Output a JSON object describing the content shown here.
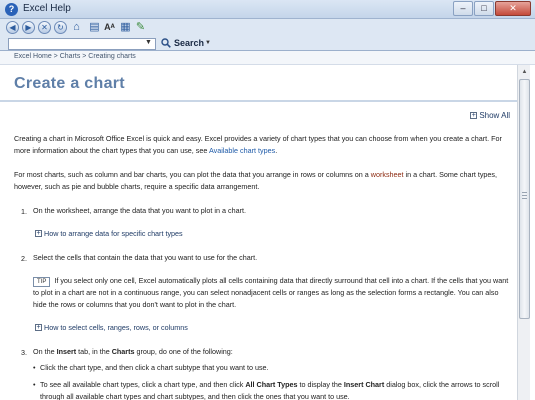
{
  "window": {
    "title": "Excel Help"
  },
  "window_buttons": {
    "minimize": "–",
    "maximize": "□",
    "close": "✕"
  },
  "search": {
    "value": "",
    "button_label": "Search"
  },
  "breadcrumb": "Excel Home > Charts > Creating charts",
  "page": {
    "title": "Create a chart",
    "show_all": "Show All"
  },
  "intro": {
    "p1_text": "Creating a chart in Microsoft Office Excel is quick and easy. Excel provides a variety of chart types that you can choose from when you create a chart. For more information about the chart types that you can use, see ",
    "p1_link": "Available chart types",
    "p1_end": ".",
    "p2_text": "For most charts, such as column and bar charts, you can plot the data that you arrange in rows or columns on a ",
    "p2_kw": "worksheet",
    "p2_end": " in a chart. Some chart types, however, such as pie and bubble charts, require a specific data arrangement."
  },
  "steps": [
    {
      "number": "1.",
      "text": "On the worksheet, arrange the data that you want to plot in a chart.",
      "expand": "How to arrange data for specific chart types"
    },
    {
      "number": "2.",
      "text": "Select the cells that contain the data that you want to use for the chart.",
      "expand": "How to select cells, ranges, rows, or columns"
    },
    {
      "number": "3.",
      "text_a": "On the ",
      "bold_a": "Insert",
      "text_b": " tab, in the ",
      "bold_b": "Charts",
      "text_c": " group, do one of the following:"
    }
  ],
  "tip": {
    "badge": "TIP",
    "text": "If you select only one cell, Excel automatically plots all cells containing data that directly surround that cell into a chart. If the cells that you want to plot in a chart are not in a continuous range, you can select nonadjacent cells or ranges as long as the selection forms a rectangle. You can also hide the rows or columns that you don't want to plot in the chart."
  },
  "bullets": {
    "b1": "Click the chart type, and then click a chart subtype that you want to use.",
    "b2_a": "To see all available chart types, click a chart type, and then click ",
    "b2_bold1": "All Chart Types",
    "b2_b": " to display the ",
    "b2_bold2": "Insert Chart",
    "b2_c": " dialog box, click the arrows to scroll through all available chart types and chart subtypes, and then click the ones that you want to use."
  }
}
